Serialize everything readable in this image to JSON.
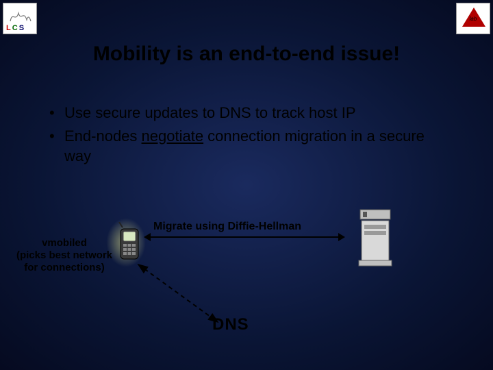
{
  "logos": {
    "left": {
      "text_l": "L",
      "text_c": "C",
      "text_s": "S"
    },
    "right": {
      "label": "lab"
    }
  },
  "title": "Mobility is an end-to-end issue!",
  "bullets": [
    {
      "pre": "Use secure updates to DNS to track host IP"
    },
    {
      "pre": "End-nodes ",
      "underlined": "negotiate",
      "post": " connection migration in a secure way"
    }
  ],
  "diagram": {
    "vmobiled": {
      "line1": "vmobiled",
      "line2": "(picks best network",
      "line3": "for connections)"
    },
    "migrate_label": "Migrate using Diffie-Hellman",
    "dns_label": "DNS"
  }
}
